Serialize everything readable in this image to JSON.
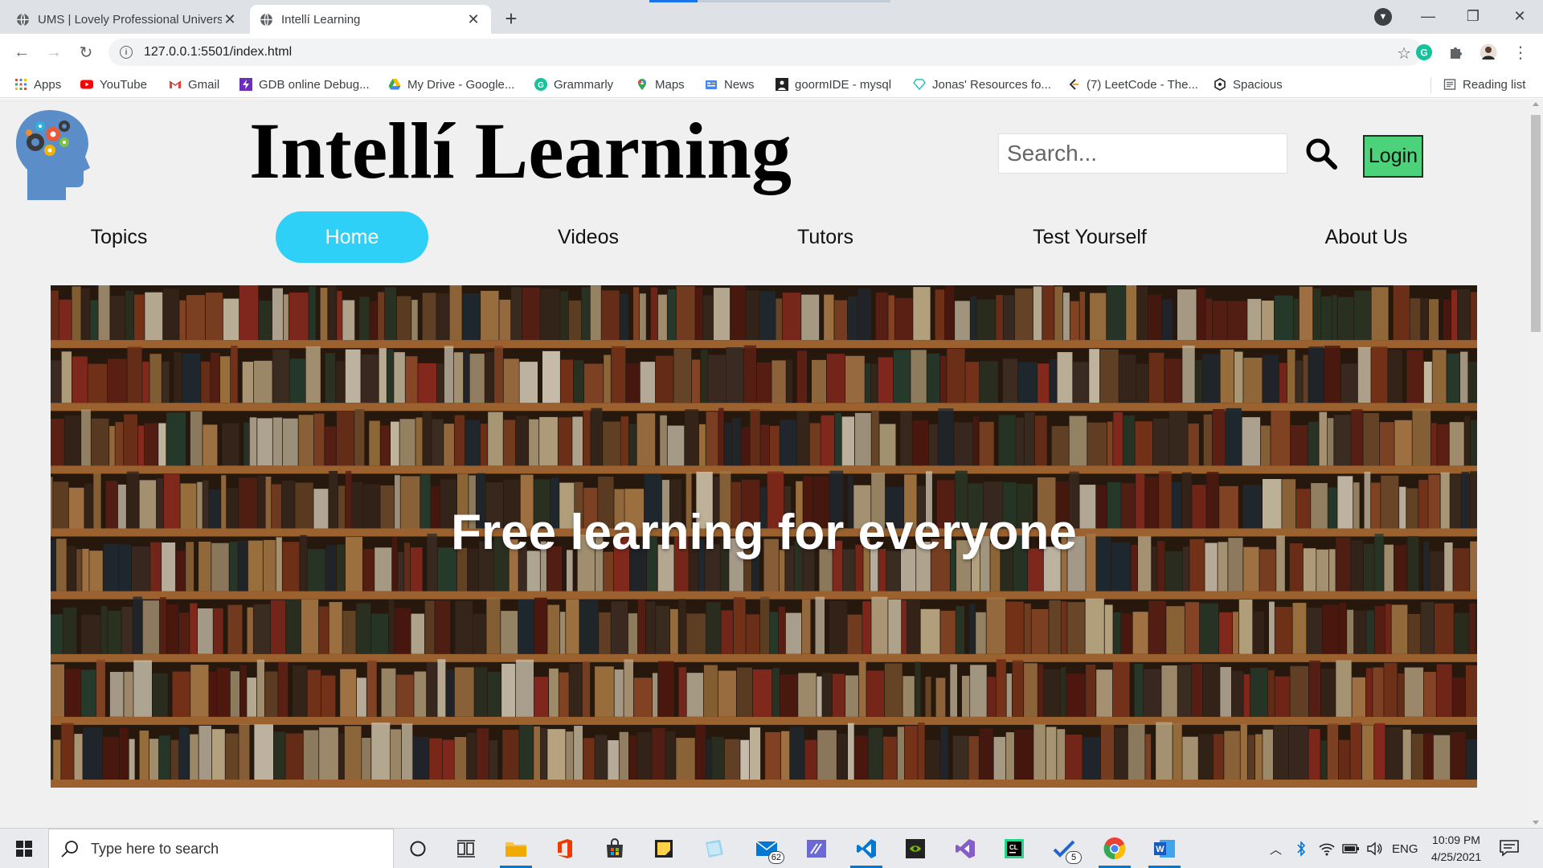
{
  "browser": {
    "tabs": [
      {
        "title": "UMS | Lovely Professional University",
        "active": false
      },
      {
        "title": "Intellí Learning",
        "active": true
      }
    ],
    "url": "127.0.0.1:5501/index.html",
    "bookmarks": [
      {
        "label": "Apps",
        "icon": "apps-grid-icon"
      },
      {
        "label": "YouTube",
        "icon": "youtube-icon"
      },
      {
        "label": "Gmail",
        "icon": "gmail-icon"
      },
      {
        "label": "GDB online Debug...",
        "icon": "gdb-icon"
      },
      {
        "label": "My Drive - Google...",
        "icon": "google-drive-icon"
      },
      {
        "label": "Grammarly",
        "icon": "grammarly-icon"
      },
      {
        "label": "Maps",
        "icon": "maps-icon"
      },
      {
        "label": "News",
        "icon": "news-icon"
      },
      {
        "label": "goormIDE - mysql",
        "icon": "goorm-icon"
      },
      {
        "label": "Jonas' Resources fo...",
        "icon": "diamond-icon"
      },
      {
        "label": "(7) LeetCode - The...",
        "icon": "leetcode-icon"
      },
      {
        "label": "Spacious",
        "icon": "spacious-icon"
      }
    ],
    "reading_list": "Reading list"
  },
  "site": {
    "brand": "Intellí Learning",
    "search_placeholder": "Search...",
    "login_label": "Login",
    "nav": [
      {
        "label": "Topics",
        "active": false
      },
      {
        "label": "Home",
        "active": true
      },
      {
        "label": "Videos",
        "active": false
      },
      {
        "label": "Tutors",
        "active": false
      },
      {
        "label": "Test Yourself",
        "active": false
      },
      {
        "label": "About Us",
        "active": false
      }
    ],
    "hero_text": "Free learning for everyone"
  },
  "taskbar": {
    "search_placeholder": "Type here to search",
    "mail_badge": "62",
    "todo_badge": "5",
    "language": "ENG",
    "time": "10:09 PM",
    "date": "4/25/2021"
  },
  "colors": {
    "nav_active": "#2fd0f7",
    "login_button": "#4cd27a",
    "page_background": "#f0f0f0"
  }
}
